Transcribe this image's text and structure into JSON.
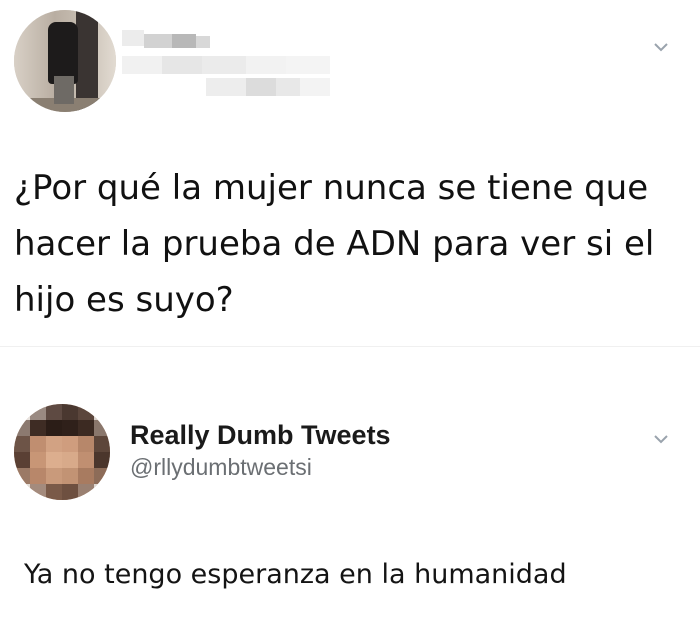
{
  "tweet1": {
    "author_name": "",
    "author_handle": "",
    "text": "¿Por qué la mujer nunca se tiene que hacer la prueba de ADN para ver si el hijo es suyo?",
    "menu_icon": "chevron-down-icon"
  },
  "tweet2": {
    "author_name": "Really Dumb Tweets",
    "author_handle": "@rllydumbtweetsi",
    "text": "Ya no tengo esperanza en la humanidad",
    "menu_icon": "chevron-down-icon"
  },
  "colors": {
    "text": "#111111",
    "handle": "#6b6f73",
    "chevron": "#9aa3ad",
    "background": "#ffffff"
  }
}
